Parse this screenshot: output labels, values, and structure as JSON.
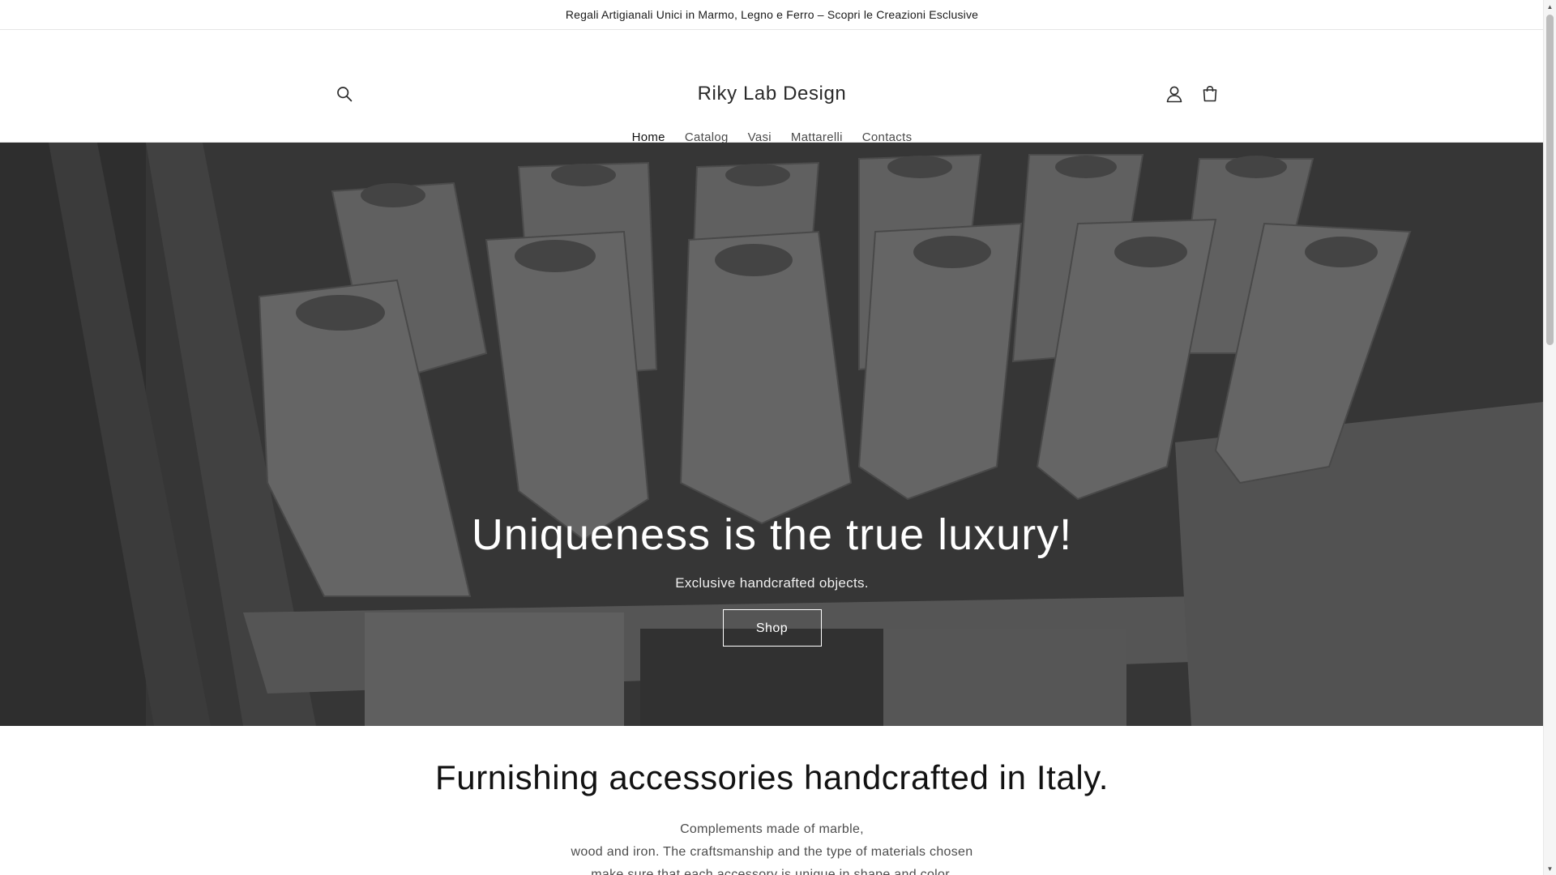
{
  "announcement": {
    "text": "Regali Artigianali Unici in Marmo, Legno e Ferro – Scopri le Creazioni Esclusive"
  },
  "header": {
    "logo": "Riky Lab Design",
    "icons": {
      "search": "search-icon",
      "account": "account-icon",
      "cart": "cart-icon"
    }
  },
  "nav": {
    "items": [
      {
        "label": "Home",
        "active": true
      },
      {
        "label": "Catalog",
        "active": false
      },
      {
        "label": "Vasi",
        "active": false
      },
      {
        "label": "Mattarelli",
        "active": false
      },
      {
        "label": "Contacts",
        "active": false
      }
    ]
  },
  "hero": {
    "title": "Uniqueness is the true luxury!",
    "subtitle": "Exclusive handcrafted objects.",
    "button_label": "Shop"
  },
  "intro": {
    "title": "Furnishing accessories handcrafted in Italy.",
    "lines": [
      "Complements made of marble,",
      "wood and iron. The craftsmanship and the type of materials chosen",
      "make sure that each accessory is unique in shape and color."
    ]
  },
  "colors": {
    "hero_overlay": "#5b5b5b",
    "text_primary": "#121212",
    "text_secondary": "#4d4d4d"
  }
}
